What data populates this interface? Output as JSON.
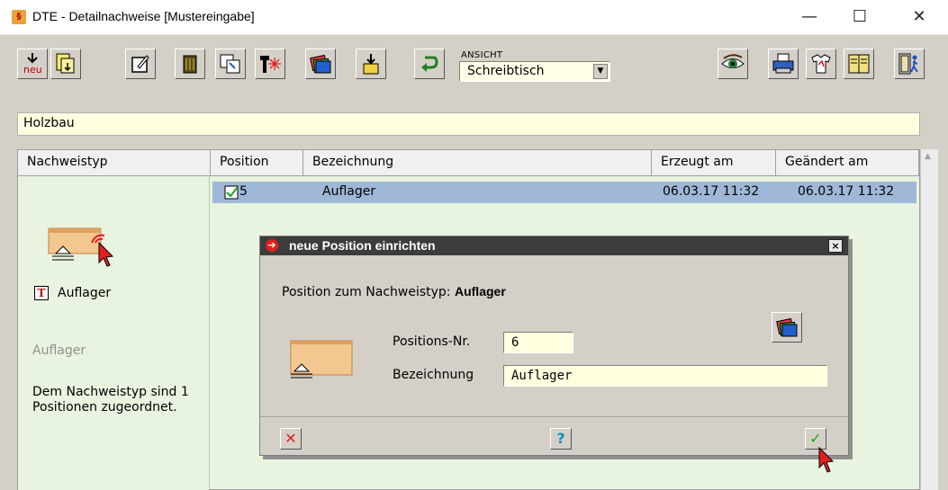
{
  "window": {
    "title": "DTE - Detailnachweise [Mustereingabe]",
    "app_icon_glyph": "§",
    "minimize_glyph": "—",
    "maximize_glyph": "☐",
    "close_glyph": "✕"
  },
  "toolbar": {
    "new_label": "neu",
    "ansicht_label": "ANSICHT",
    "ansicht_value": "Schreibtisch",
    "icons": [
      "new-icon",
      "import-icon",
      "edit-icon",
      "delete-icon",
      "copy-icon",
      "hammer-icon",
      "card-stack-icon",
      "export-icon",
      "refresh-icon",
      "eye-icon",
      "printer-icon",
      "shirt-icon",
      "book-icon",
      "exit-icon"
    ]
  },
  "category": "Holzbau",
  "table": {
    "headers": {
      "nachweistyp": "Nachweistyp",
      "position": "Position",
      "bezeichnung": "Bezeichnung",
      "erzeugt": "Erzeugt am",
      "geaendert": "Geändert am"
    },
    "rows": [
      {
        "position": "5",
        "bezeichnung": "Auflager",
        "erzeugt": "06.03.17 11:32",
        "geaendert": "06.03.17 11:32"
      }
    ]
  },
  "left_panel": {
    "type_label": "Auflager",
    "type_heading": "Auflager",
    "description": "Dem Nachweistyp sind 1 Positionen zugeordnet."
  },
  "dialog": {
    "title": "neue Position einrichten",
    "close_glyph": "×",
    "prompt": "Position zum Nachweistyp:",
    "prompt_value": "Auflager",
    "nr_label": "Positions-Nr.",
    "nr_value": "6",
    "bez_label": "Bezeichnung",
    "bez_value": "Auflager",
    "cancel_glyph": "✕",
    "help_glyph": "?",
    "ok_glyph": "✓"
  },
  "colors": {
    "toolbar": "#d4d0c8",
    "category_bar": "#ffffe0",
    "panel": "#e8f4e0",
    "selected_row": "#9fb8d8",
    "dialog_title": "#3c3c3c"
  }
}
